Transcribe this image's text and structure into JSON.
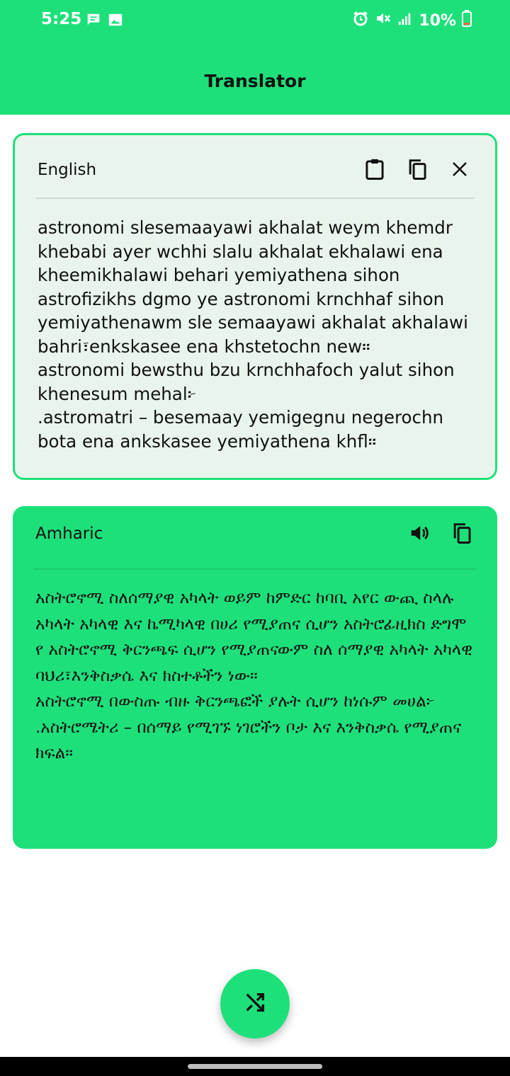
{
  "status_bar": {
    "time": "5:25",
    "battery_text": "10%",
    "icons": [
      "chat-notification-icon",
      "image-notification-icon",
      "alarm-icon",
      "mute-icon",
      "signal-icon",
      "battery-low-icon"
    ]
  },
  "app_bar": {
    "title": "Translator"
  },
  "source": {
    "language": "English",
    "text": "astronomi slesemaayawi akhalat weym khemdr khebabi ayer wchhi slalu akhalat ekhalawi ena kheemikhalawi behari yemiyathena sihon astrofizikhs dgmo ye astronomi krnchhaf sihon yemiyathenawm sle semaayawi akhalat akhalawi bahri፣enkskasee ena khstetochn new።\nastronomi bewsthu bzu krnchhafoch yalut sihon khenesum mehal፦\n.astromatri – besemaay yemigegnu negerochn bota ena ankskasee yemiyathena khfl።",
    "icons": [
      "clipboard-paste-icon",
      "copy-icon",
      "close-icon"
    ]
  },
  "target": {
    "language": "Amharic",
    "text": "አስትሮኖሚ ስለሰማያዊ አካላት ወይም ከምድር ከባቢ አየር ውጪ ስላሉ አካላት አካላዊ እና ኬሚካላዊ በሀሪ የሚያጠና ሲሆን አስትሮፊዚክስ ድግሞ የ አስትሮኖሚ ቅርንጫፍ ሲሆን የሚያጠናውም ስለ ሰማያዊ አካላት አካላዊ ባህሪ፣እንቅስቃሴ እና ክስተቶችን ነው።\nአስትሮኖሚ በውስጡ ብዙ ቅርንጫፎች ያሉት ሲሆን ከነሱም መሀል፦\n.አስትሮሜትሪ – በሰማይ የሚገኙ ነገሮችን ቦታ እና እንቅስቃሴ የሚያጠና ክፍል።",
    "icons": [
      "speaker-icon",
      "copy-icon"
    ]
  },
  "fab": {
    "icon": "shuffle-icon"
  },
  "colors": {
    "accent": "#1ee07a",
    "source_bg": "#e9f5ec",
    "text": "#111111"
  }
}
